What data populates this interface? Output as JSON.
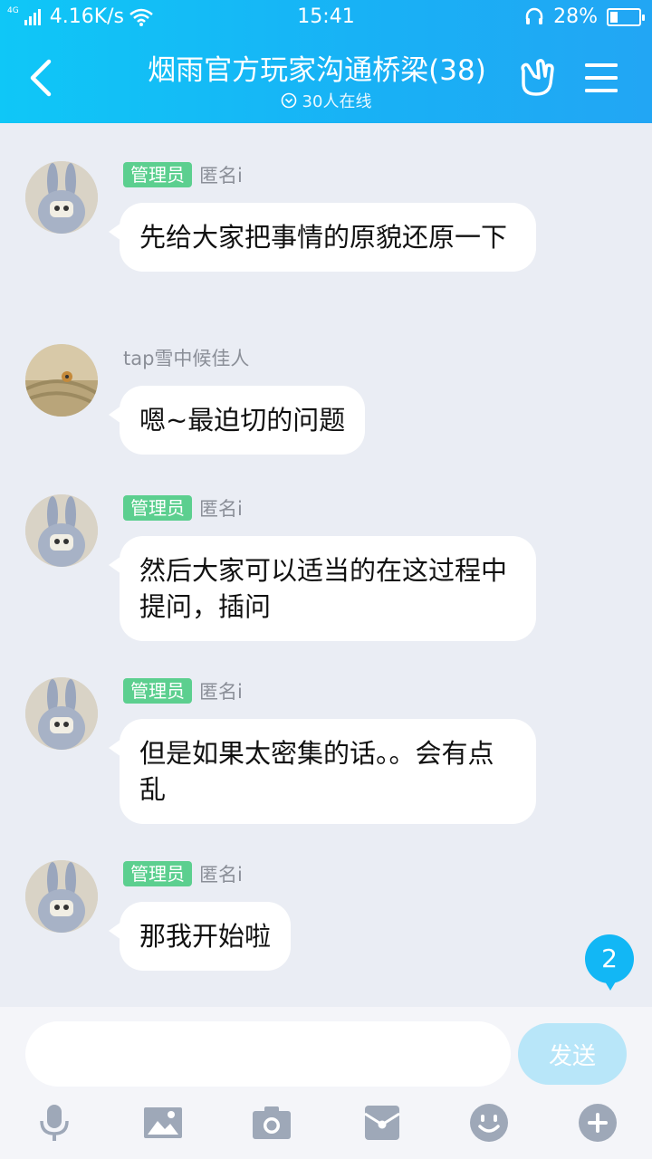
{
  "status_bar": {
    "network": "4G",
    "speed": "4.16K/s",
    "time": "15:41",
    "battery_text": "28%",
    "battery_level": 0.28
  },
  "header": {
    "title": "烟雨官方玩家沟通桥梁(38)",
    "online": "30人在线"
  },
  "messages": [
    {
      "role": "管理员",
      "nick": "匿名i",
      "text": "先给大家把事情的原貌还原一下",
      "avatar": "rabbit-avatar"
    },
    {
      "role": "",
      "nick": "tap雪中候佳人",
      "text": "嗯~最迫切的问题",
      "avatar": "photo-avatar"
    },
    {
      "role": "管理员",
      "nick": "匿名i",
      "text": "然后大家可以适当的在这过程中提问，插问",
      "avatar": "rabbit-avatar"
    },
    {
      "role": "管理员",
      "nick": "匿名i",
      "text": "但是如果太密集的话。。会有点乱",
      "avatar": "rabbit-avatar"
    },
    {
      "role": "管理员",
      "nick": "匿名i",
      "text": "那我开始啦",
      "avatar": "rabbit-avatar"
    }
  ],
  "unread_count": "2",
  "input": {
    "value": "",
    "placeholder": "",
    "send_label": "发送"
  },
  "toolbar_icons": [
    "microphone-icon",
    "image-icon",
    "camera-icon",
    "red-packet-icon",
    "emoji-icon",
    "plus-icon"
  ],
  "colors": {
    "header_start": "#0fc7f7",
    "header_end": "#22a6f4",
    "admin_badge": "#5ccf8f",
    "unread_badge": "#12b7f5",
    "send_disabled": "#b8e6f9",
    "toolbar_icon": "#9ea8b8"
  }
}
